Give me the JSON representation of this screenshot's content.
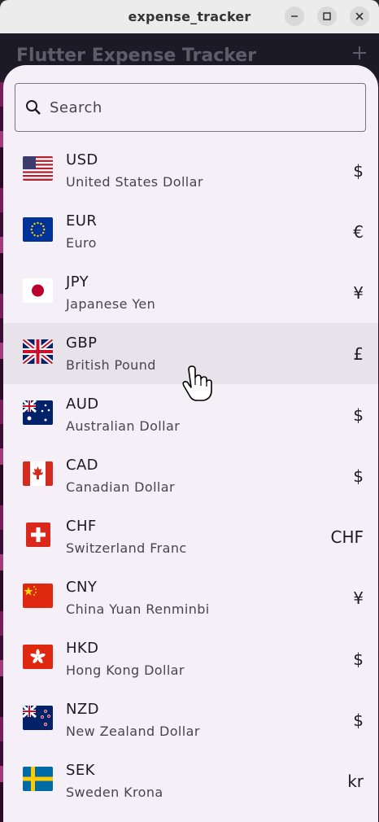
{
  "window": {
    "title": "expense_tracker"
  },
  "app": {
    "title": "Flutter Expense Tracker"
  },
  "search": {
    "placeholder": "Search"
  },
  "currencies": [
    {
      "code": "USD",
      "name": "United States Dollar",
      "symbol": "$",
      "flag": "us-flag-icon"
    },
    {
      "code": "EUR",
      "name": "Euro",
      "symbol": "€",
      "flag": "eu-flag-icon"
    },
    {
      "code": "JPY",
      "name": "Japanese Yen",
      "symbol": "¥",
      "flag": "jp-flag-icon"
    },
    {
      "code": "GBP",
      "name": "British Pound",
      "symbol": "£",
      "flag": "gb-flag-icon"
    },
    {
      "code": "AUD",
      "name": "Australian Dollar",
      "symbol": "$",
      "flag": "au-flag-icon"
    },
    {
      "code": "CAD",
      "name": "Canadian Dollar",
      "symbol": "$",
      "flag": "ca-flag-icon"
    },
    {
      "code": "CHF",
      "name": "Switzerland Franc",
      "symbol": "CHF",
      "flag": "ch-flag-icon"
    },
    {
      "code": "CNY",
      "name": "China Yuan Renminbi",
      "symbol": "¥",
      "flag": "cn-flag-icon"
    },
    {
      "code": "HKD",
      "name": "Hong Kong Dollar",
      "symbol": "$",
      "flag": "hk-flag-icon"
    },
    {
      "code": "NZD",
      "name": "New Zealand Dollar",
      "symbol": "$",
      "flag": "nz-flag-icon"
    },
    {
      "code": "SEK",
      "name": "Sweden Krona",
      "symbol": "kr",
      "flag": "se-flag-icon"
    }
  ],
  "colors": {
    "sheet": "#f5eff7",
    "hover": "#e8e2ea",
    "text": "#1d1b20",
    "subtext": "#49454f"
  }
}
